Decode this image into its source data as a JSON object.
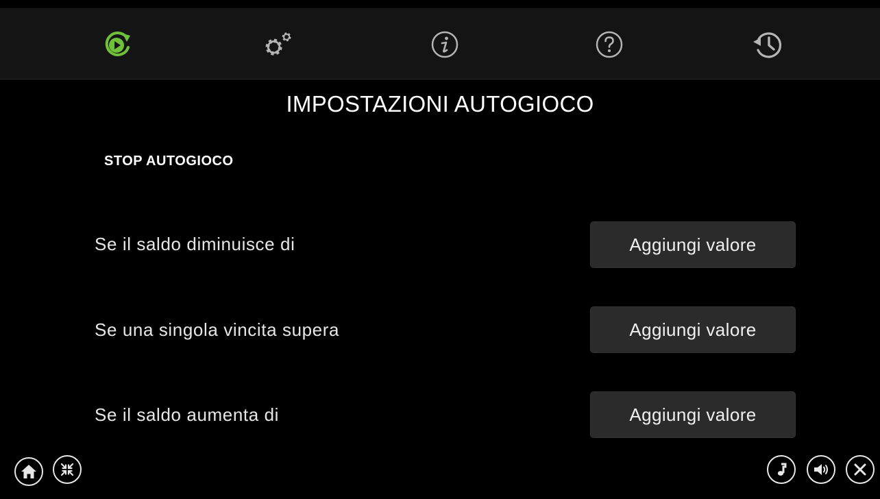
{
  "nav": {
    "tabs": [
      {
        "id": "autoplay",
        "icon": "autoplay-icon",
        "active": true
      },
      {
        "id": "settings",
        "icon": "settings-gears-icon",
        "active": false
      },
      {
        "id": "info",
        "icon": "info-icon",
        "active": false
      },
      {
        "id": "help",
        "icon": "help-icon",
        "active": false
      },
      {
        "id": "history",
        "icon": "history-icon",
        "active": false
      }
    ],
    "active_color": "#6fc13a",
    "inactive_color": "#b5b5b5"
  },
  "page": {
    "title": "IMPOSTAZIONI AUTOGIOCO",
    "section_title": "STOP AUTOGIOCO"
  },
  "rows": [
    {
      "label": "Se il saldo diminuisce di",
      "button": "Aggiungi valore"
    },
    {
      "label": "Se una singola vincita supera",
      "button": "Aggiungi valore"
    },
    {
      "label": "Se il saldo aumenta di",
      "button": "Aggiungi valore"
    }
  ],
  "footer": {
    "left_buttons": [
      "home-icon",
      "fullscreen-exit-icon"
    ],
    "right_buttons": [
      "music-icon",
      "sound-icon",
      "close-icon"
    ]
  }
}
